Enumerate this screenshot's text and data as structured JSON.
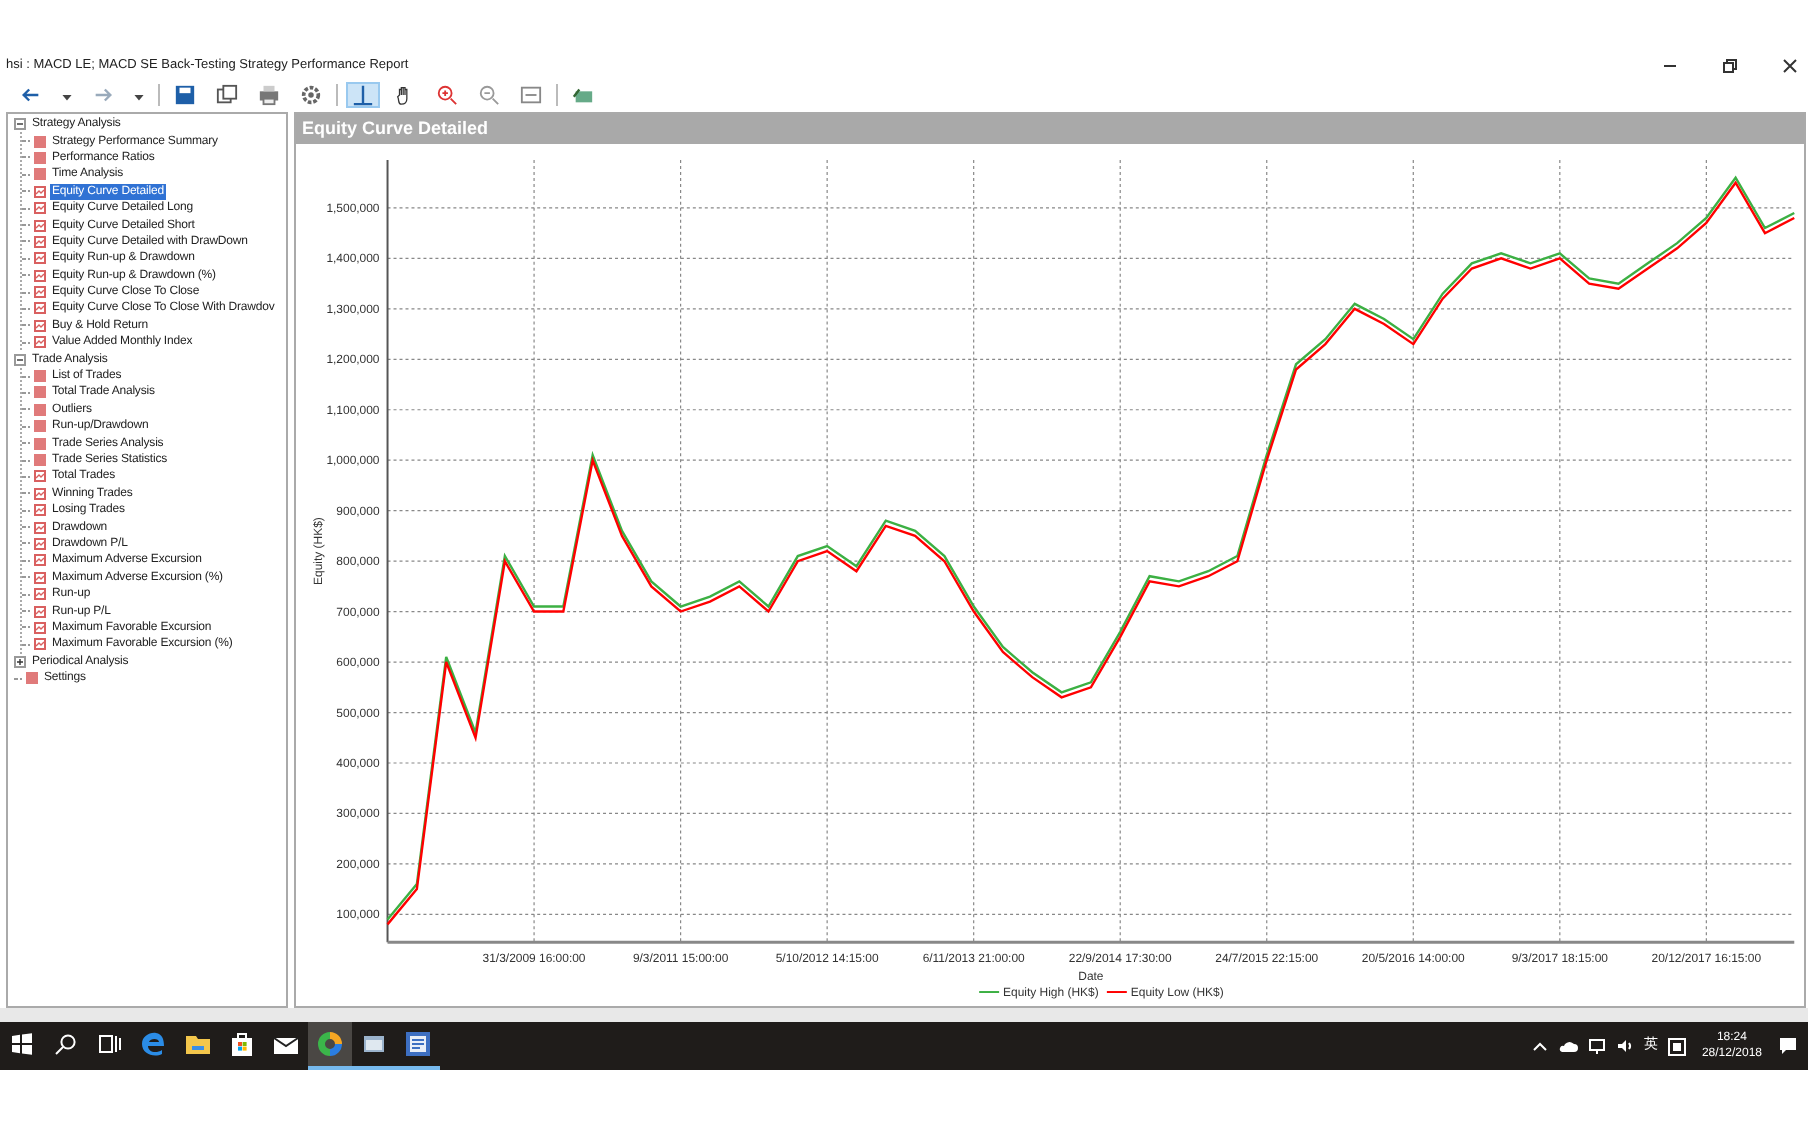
{
  "window": {
    "title": "hsi : MACD LE; MACD SE Back-Testing Strategy Performance Report"
  },
  "toolbar": [
    {
      "kind": "back",
      "selected": false
    },
    {
      "kind": "dropdown",
      "selected": false
    },
    {
      "kind": "forward",
      "selected": false
    },
    {
      "kind": "dropdown",
      "selected": false
    },
    {
      "kind": "save",
      "selected": false
    },
    {
      "kind": "copy",
      "selected": false
    },
    {
      "kind": "print",
      "selected": false
    },
    {
      "kind": "settings",
      "selected": false
    },
    {
      "kind": "cursor",
      "selected": true
    },
    {
      "kind": "hand",
      "selected": false
    },
    {
      "kind": "zoom-in",
      "selected": false
    },
    {
      "kind": "zoom-out",
      "selected": false
    },
    {
      "kind": "fit",
      "selected": false
    },
    {
      "kind": "export",
      "selected": false
    }
  ],
  "tree": [
    {
      "label": "Strategy Analysis",
      "kind": "group",
      "expanded": true,
      "children": [
        {
          "label": "Strategy Performance Summary",
          "kind": "report",
          "selected": false
        },
        {
          "label": "Performance Ratios",
          "kind": "report",
          "selected": false
        },
        {
          "label": "Time Analysis",
          "kind": "report",
          "selected": false
        },
        {
          "label": "Equity Curve Detailed",
          "kind": "chart",
          "selected": true
        },
        {
          "label": "Equity Curve Detailed Long",
          "kind": "chart",
          "selected": false
        },
        {
          "label": "Equity Curve Detailed Short",
          "kind": "chart",
          "selected": false
        },
        {
          "label": "Equity Curve Detailed with DrawDown",
          "kind": "chart",
          "selected": false
        },
        {
          "label": "Equity Run-up & Drawdown",
          "kind": "chart",
          "selected": false
        },
        {
          "label": "Equity Run-up & Drawdown (%)",
          "kind": "chart",
          "selected": false
        },
        {
          "label": "Equity Curve Close To Close",
          "kind": "chart",
          "selected": false
        },
        {
          "label": "Equity Curve Close To Close With Drawdov",
          "kind": "chart",
          "selected": false
        },
        {
          "label": "Buy & Hold Return",
          "kind": "chart",
          "selected": false
        },
        {
          "label": "Value Added Monthly Index",
          "kind": "chart",
          "selected": false
        }
      ]
    },
    {
      "label": "Trade Analysis",
      "kind": "group",
      "expanded": true,
      "children": [
        {
          "label": "List of Trades",
          "kind": "report",
          "selected": false
        },
        {
          "label": "Total Trade Analysis",
          "kind": "report",
          "selected": false
        },
        {
          "label": "Outliers",
          "kind": "report",
          "selected": false
        },
        {
          "label": "Run-up/Drawdown",
          "kind": "report",
          "selected": false
        },
        {
          "label": "Trade Series Analysis",
          "kind": "report",
          "selected": false
        },
        {
          "label": "Trade Series Statistics",
          "kind": "report",
          "selected": false
        },
        {
          "label": "Total Trades",
          "kind": "chart",
          "selected": false
        },
        {
          "label": "Winning Trades",
          "kind": "chart",
          "selected": false
        },
        {
          "label": "Losing Trades",
          "kind": "chart",
          "selected": false
        },
        {
          "label": "Drawdown",
          "kind": "chart",
          "selected": false
        },
        {
          "label": "Drawdown P/L",
          "kind": "chart",
          "selected": false
        },
        {
          "label": "Maximum Adverse Excursion",
          "kind": "chart",
          "selected": false
        },
        {
          "label": "Maximum Adverse Excursion (%)",
          "kind": "chart",
          "selected": false
        },
        {
          "label": "Run-up",
          "kind": "chart",
          "selected": false
        },
        {
          "label": "Run-up P/L",
          "kind": "chart",
          "selected": false
        },
        {
          "label": "Maximum Favorable Excursion",
          "kind": "chart",
          "selected": false
        },
        {
          "label": "Maximum Favorable Excursion (%)",
          "kind": "chart",
          "selected": false
        }
      ]
    },
    {
      "label": "Periodical Analysis",
      "kind": "group",
      "expanded": false
    },
    {
      "label": "Settings",
      "kind": "report",
      "selected": false
    }
  ],
  "panel": {
    "title": "Equity Curve Detailed",
    "chart_data": {
      "type": "line",
      "xlabel": "Date",
      "ylabel": "Equity (HK$)",
      "categories": [
        null,
        null,
        null,
        null,
        null,
        "31/3/2009 16:00:00",
        null,
        null,
        null,
        null,
        "9/3/2011 15:00:00",
        null,
        null,
        null,
        null,
        "5/10/2012 14:15:00",
        null,
        null,
        null,
        null,
        "6/11/2013 21:00:00",
        null,
        null,
        null,
        null,
        "22/9/2014 17:30:00",
        null,
        null,
        null,
        null,
        "24/7/2015 22:15:00",
        null,
        null,
        null,
        null,
        "20/5/2016 14:00:00",
        null,
        null,
        null,
        null,
        "9/3/2017 18:15:00",
        null,
        null,
        null,
        null,
        "20/12/2017 16:15:00",
        null,
        null,
        null
      ],
      "series": [
        {
          "name": "Equity High (HK$)",
          "color": "#3cb043",
          "values": [
            90000,
            160000,
            610000,
            460000,
            810000,
            710000,
            710000,
            1010000,
            860000,
            760000,
            710000,
            730000,
            760000,
            710000,
            810000,
            830000,
            790000,
            880000,
            860000,
            810000,
            710000,
            630000,
            580000,
            540000,
            560000,
            660000,
            770000,
            760000,
            780000,
            810000,
            1010000,
            1190000,
            1240000,
            1310000,
            1280000,
            1240000,
            1330000,
            1390000,
            1410000,
            1390000,
            1410000,
            1360000,
            1350000,
            1390000,
            1430000,
            1480000,
            1560000,
            1460000,
            1490000
          ]
        },
        {
          "name": "Equity Low (HK$)",
          "color": "#ff0000",
          "values": [
            80000,
            150000,
            600000,
            450000,
            800000,
            700000,
            700000,
            1000000,
            850000,
            750000,
            700000,
            720000,
            750000,
            700000,
            800000,
            820000,
            780000,
            870000,
            850000,
            800000,
            700000,
            620000,
            570000,
            530000,
            550000,
            650000,
            760000,
            750000,
            770000,
            800000,
            1000000,
            1180000,
            1230000,
            1300000,
            1270000,
            1230000,
            1320000,
            1380000,
            1400000,
            1380000,
            1400000,
            1350000,
            1340000,
            1380000,
            1420000,
            1470000,
            1550000,
            1450000,
            1480000
          ]
        }
      ],
      "ylim": [
        45000,
        1595000
      ],
      "grid": true,
      "legend": "bottom",
      "yticks": [
        {
          "value": 100000,
          "label": "100,000"
        },
        {
          "value": 200000,
          "label": "200,000"
        },
        {
          "value": 300000,
          "label": "300,000"
        },
        {
          "value": 400000,
          "label": "400,000"
        },
        {
          "value": 500000,
          "label": "500,000"
        },
        {
          "value": 600000,
          "label": "600,000"
        },
        {
          "value": 700000,
          "label": "700,000"
        },
        {
          "value": 800000,
          "label": "800,000"
        },
        {
          "value": 900000,
          "label": "900,000"
        },
        {
          "value": 1000000,
          "label": "1,000,000"
        },
        {
          "value": 1100000,
          "label": "1,100,000"
        },
        {
          "value": 1200000,
          "label": "1,200,000"
        },
        {
          "value": 1300000,
          "label": "1,300,000"
        },
        {
          "value": 1400000,
          "label": "1,400,000"
        },
        {
          "value": 1500000,
          "label": "1,500,000"
        }
      ]
    }
  },
  "taskbar": {
    "apps": [
      {
        "kind": "start",
        "running": false,
        "active": false
      },
      {
        "kind": "search",
        "running": false,
        "active": false
      },
      {
        "kind": "taskview",
        "running": false,
        "active": false
      },
      {
        "kind": "edge",
        "running": false,
        "active": false
      },
      {
        "kind": "folder",
        "running": false,
        "active": false
      },
      {
        "kind": "store",
        "running": false,
        "active": false
      },
      {
        "kind": "mail",
        "running": false,
        "active": false
      },
      {
        "kind": "circle",
        "running": true,
        "active": true
      },
      {
        "kind": "window",
        "running": true,
        "active": false
      },
      {
        "kind": "document",
        "running": true,
        "active": false
      }
    ],
    "ime": "英",
    "time": "18:24",
    "date": "28/12/2018"
  }
}
